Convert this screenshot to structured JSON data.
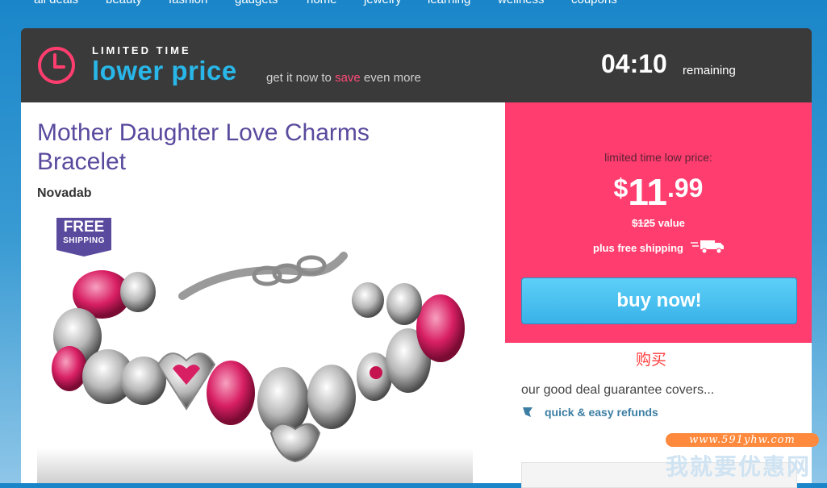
{
  "nav": {
    "items": [
      "all deals",
      "beauty",
      "fashion",
      "gadgets",
      "home",
      "jewelry",
      "learning",
      "wellness",
      "coupons"
    ]
  },
  "banner": {
    "label": "LIMITED TIME",
    "title": "lower price",
    "sub_prefix": "get it now to ",
    "sub_highlight": "save",
    "sub_suffix": " even more",
    "timer": "04:10",
    "remaining": "remaining",
    "icon": "clock-icon"
  },
  "product": {
    "title": "Mother Daughter Love Charms Bracelet",
    "brand": "Novadab",
    "badge_line1": "FREE",
    "badge_line2": "SHIPPING",
    "image": "charm-bracelet-image"
  },
  "price": {
    "label": "limited time low price:",
    "currency": "$",
    "dollars": "11",
    "cents": ".99",
    "value_text": "$125",
    "value_suffix": " value",
    "shipping": "plus free shipping",
    "buy_label": "buy now!"
  },
  "guarantee": {
    "cn_label": "购买",
    "text": "our good deal guarantee covers...",
    "refunds": "quick & easy refunds"
  },
  "watermark": {
    "url": "www.591yhw.com",
    "cn": "我就要优惠网"
  },
  "colors": {
    "accent_blue": "#29b6e8",
    "accent_pink": "#ff3d6e",
    "title_purple": "#5a4a9e",
    "banner_dark": "#3a3a3a"
  }
}
